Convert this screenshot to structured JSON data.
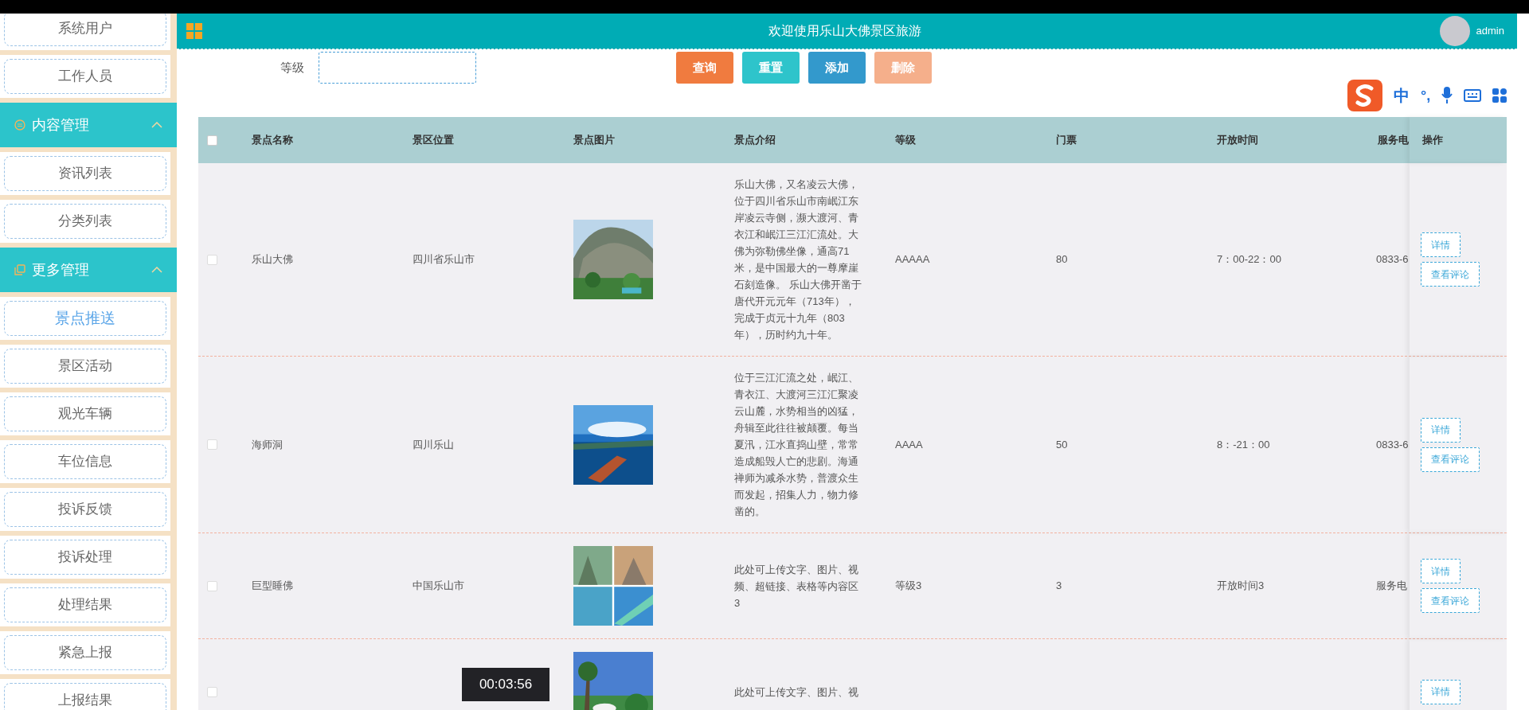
{
  "sidebar": [
    {
      "kind": "item",
      "label": "系统用户",
      "selected": false
    },
    {
      "kind": "item",
      "label": "工作人员",
      "selected": false
    },
    {
      "kind": "section",
      "label": "内容管理",
      "expanded": true
    },
    {
      "kind": "item",
      "label": "资讯列表",
      "selected": false
    },
    {
      "kind": "item",
      "label": "分类列表",
      "selected": false
    },
    {
      "kind": "section",
      "label": "更多管理",
      "expanded": true
    },
    {
      "kind": "item",
      "label": "景点推送",
      "selected": true
    },
    {
      "kind": "item",
      "label": "景区活动",
      "selected": false
    },
    {
      "kind": "item",
      "label": "观光车辆",
      "selected": false
    },
    {
      "kind": "item",
      "label": "车位信息",
      "selected": false
    },
    {
      "kind": "item",
      "label": "投诉反馈",
      "selected": false
    },
    {
      "kind": "item",
      "label": "投诉处理",
      "selected": false
    },
    {
      "kind": "item",
      "label": "处理结果",
      "selected": false
    },
    {
      "kind": "item",
      "label": "紧急上报",
      "selected": false
    },
    {
      "kind": "item",
      "label": "上报结果",
      "selected": false
    }
  ],
  "header": {
    "title": "欢迎使用乐山大佛景区旅游",
    "user": "admin"
  },
  "search": {
    "label": "等级"
  },
  "buttons": [
    {
      "label": "查询",
      "kind": "query",
      "disabled": false
    },
    {
      "label": "重置",
      "kind": "reset",
      "disabled": false
    },
    {
      "label": "添加",
      "kind": "add",
      "disabled": false
    },
    {
      "label": "删除",
      "kind": "delete",
      "disabled": true
    }
  ],
  "table": {
    "all_selected": false,
    "columns": [
      "景点名称",
      "景区位置",
      "景点图片",
      "景点介绍",
      "等级",
      "门票",
      "开放时间",
      "服务电",
      "操作"
    ],
    "rows": [
      {
        "selected": false,
        "name": "乐山大佛",
        "location": "四川省乐山市",
        "picture": {
          "kind": "picture"
        },
        "intro": "乐山大佛，又名凌云大佛，位于四川省乐山市南岷江东岸凌云寺侧，濒大渡河、青衣江和岷江三江汇流处。大佛为弥勒佛坐像，通高71米，是中国最大的一尊摩崖石刻造像。 乐山大佛开凿于唐代开元元年（713年），完成于贞元十九年（803年），历时约九十年。",
        "level": "AAAAA",
        "ticket": "80",
        "time": "7：00-22：00",
        "phone": "0833-6",
        "actions": [
          "详情",
          "查看评论"
        ]
      },
      {
        "selected": false,
        "name": "海师洞",
        "location": "四川乐山",
        "picture": {
          "kind": "picture"
        },
        "intro": "位于三江汇流之处，岷江、青衣江、大渡河三江汇聚凌云山麓，水势相当的凶猛，舟辑至此往往被颠覆。每当夏汛，江水直捣山壁，常常造成船毁人亡的悲剧。海通禅师为减杀水势，普渡众生而发起，招集人力，物力修凿的。",
        "level": "AAAA",
        "ticket": "50",
        "time": "8：-21：00",
        "phone": "0833-6",
        "actions": [
          "详情",
          "查看评论"
        ]
      },
      {
        "selected": false,
        "name": "巨型睡佛",
        "location": "中国乐山市",
        "picture": {
          "kind": "picture"
        },
        "intro": "此处可上传文字、图片、视频、超链接、表格等内容区3",
        "level": "等级3",
        "ticket": "3",
        "time": "开放时间3",
        "phone": "服务电",
        "actions": [
          "详情",
          "查看评论"
        ]
      },
      {
        "selected": false,
        "picture": {
          "kind": "picture"
        },
        "intro": "此处可上传文字、图片、视",
        "actions": [
          "详情"
        ]
      }
    ]
  },
  "ime": {
    "mode": "中",
    "punct": "°,"
  },
  "timestamp": "00:03:56"
}
